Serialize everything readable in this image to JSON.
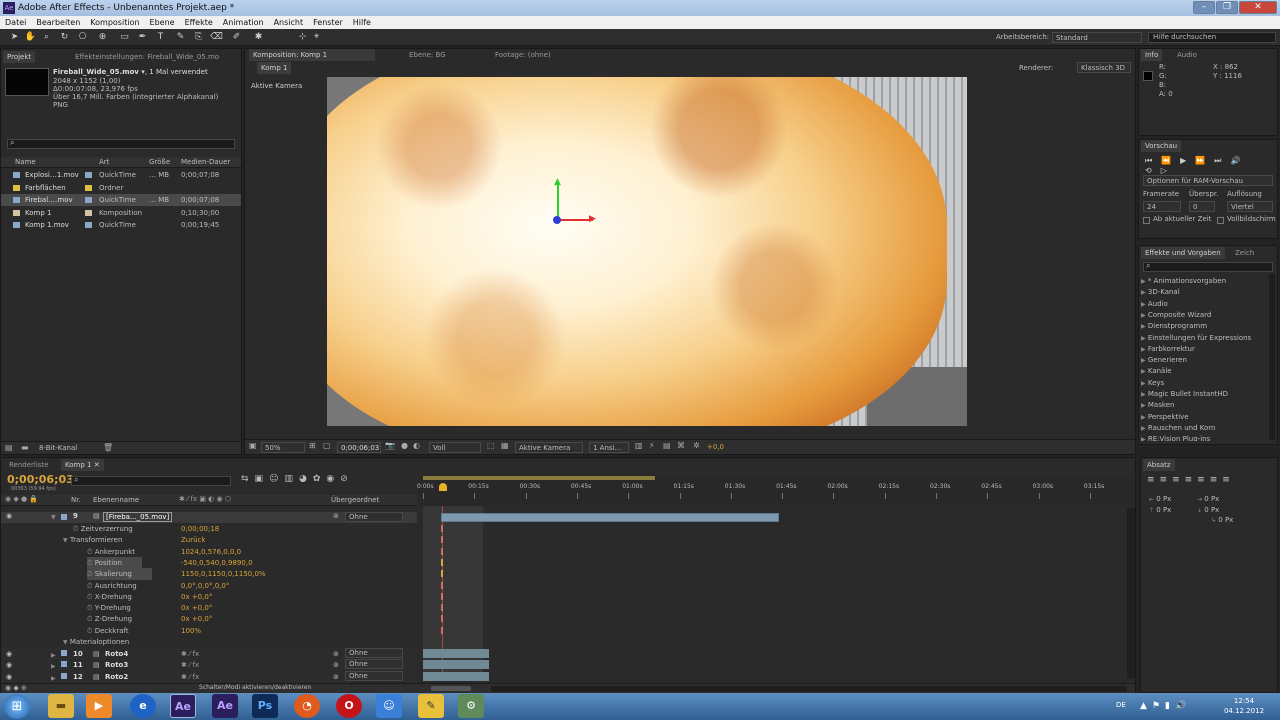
{
  "window": {
    "title": "Adobe After Effects - Unbenanntes Projekt.aep *"
  },
  "menu": [
    "Datei",
    "Bearbeiten",
    "Komposition",
    "Ebene",
    "Effekte",
    "Animation",
    "Ansicht",
    "Fenster",
    "Hilfe"
  ],
  "toolbar": {
    "workspace_label": "Arbeitsbereich:",
    "workspace_value": "Standard",
    "help_placeholder": "Hilfe durchsuchen"
  },
  "project": {
    "tab": "Projekt",
    "tab2": "Effekteinstellungen: Fireball_Wide_05.mo",
    "file_name": "Fireball_Wide_05.mov ▾",
    "used": ", 1 Mal verwendet",
    "info": [
      "2048 x 1152 (1,00)",
      "Δ0:00:07:08, 23,976 fps",
      "Über 16,7 Mill. Farben (integrierter Alphakanal)",
      "PNG"
    ],
    "columns": [
      "Name",
      "Art",
      "Größe",
      "Medien-Dauer"
    ],
    "items": [
      {
        "name": "Explosi…1.mov",
        "type": "QuickTime",
        "size": "… MB",
        "dur": "0;00;07;08",
        "color": "#8aa7c9"
      },
      {
        "name": "Farbflächen",
        "type": "Ordner",
        "size": "",
        "dur": "",
        "color": "#e0c040"
      },
      {
        "name": "Firebal….mov",
        "type": "QuickTime",
        "size": "… MB",
        "dur": "0;00;07;08",
        "color": "#8aa7c9"
      },
      {
        "name": "Komp 1",
        "type": "Komposition",
        "size": "",
        "dur": "0;10;30;00",
        "color": "#d4c5a0"
      },
      {
        "name": "Komp 1.mov",
        "type": "QuickTime",
        "size": "",
        "dur": "0;00;19;45",
        "color": "#8aa7c9"
      }
    ],
    "bitdepth": "8-Bit-Kanal"
  },
  "comp": {
    "tab": "Komposition: Komp 1",
    "tab_layer": "Ebene: BG",
    "tab_footage": "Footage: (ohne)",
    "subtab": "Komp 1",
    "renderer_label": "Renderer:",
    "renderer": "Klassisch 3D",
    "camera_label": "Aktive Kamera",
    "zoom": "50%",
    "timecode": "0;00;06;03",
    "resolution": "Voll",
    "view": "Aktive Kamera",
    "views": "1 Ansi...",
    "exposure": "+0,0"
  },
  "info_panel": {
    "tab": "Info",
    "tab2": "Audio",
    "r": "R:",
    "g": "G:",
    "b": "B:",
    "a": "A: 0",
    "x": "X : 862",
    "y": "Y : 1116"
  },
  "preview": {
    "tab": "Vorschau",
    "options": "Optionen für RAM-Vorschau",
    "framerate_label": "Framerate",
    "skip_label": "Überspr.",
    "res_label": "Auflösung",
    "framerate": "24",
    "skip": "0",
    "res": "Viertel",
    "from_current": "Ab aktueller Zeit",
    "fullscreen": "Vollbildschirm"
  },
  "effects": {
    "tab": "Effekte und Vorgaben",
    "tab2": "Zeich",
    "items": [
      "* Animationsvorgaben",
      "3D-Kanal",
      "Audio",
      "Composite Wizard",
      "Dienstprogramm",
      "Einstellungen für Expressions",
      "Farbkorrektur",
      "Generieren",
      "Kanäle",
      "Keys",
      "Magic Bullet InstantHD",
      "Masken",
      "Perspektive",
      "Rauschen und Korn",
      "RE:Vision Plug-ins"
    ]
  },
  "paragraph": {
    "tab": "Absatz",
    "values": [
      "0 Px",
      "0 Px",
      "0 Px",
      "0 Px",
      "0 Px"
    ]
  },
  "timeline": {
    "tab1": "Renderliste",
    "tab2": "Komp 1",
    "timecode": "0;00;06;03",
    "frames": "00363 (59.94 fps)",
    "col_nr": "Nr.",
    "col_name": "Ebenenname",
    "col_parent": "Übergeordnet",
    "ruler": [
      "0:00s",
      "00:15s",
      "00:30s",
      "00:45s",
      "01:00s",
      "01:15s",
      "01:30s",
      "01:45s",
      "02:00s",
      "02:15s",
      "02:30s",
      "02:45s",
      "03:00s",
      "03:15s"
    ],
    "layer9": {
      "nr": "9",
      "name": "[Fireba..._05.mov]",
      "parent": "Ohne"
    },
    "props": [
      {
        "label": "Zeitverzerrung",
        "value": "0;00;00;18",
        "indent": 1
      },
      {
        "label": "Transformieren",
        "value": "Zurück",
        "indent": 0
      },
      {
        "label": "Ankerpunkt",
        "value": "1024,0,576,0,0,0",
        "indent": 2
      },
      {
        "label": "Position",
        "value": "-540,0,540,0,9890,0",
        "indent": 2
      },
      {
        "label": "Skalierung",
        "value": "1150,0,1150,0,1150,0%",
        "indent": 2
      },
      {
        "label": "Ausrichtung",
        "value": "0,0°,0,0°,0,0°",
        "indent": 2
      },
      {
        "label": "X-Drehung",
        "value": "0x +0,0°",
        "indent": 2
      },
      {
        "label": "Y-Drehung",
        "value": "0x +0,0°",
        "indent": 2
      },
      {
        "label": "Z-Drehung",
        "value": "0x +0,0°",
        "indent": 2
      },
      {
        "label": "Deckkraft",
        "value": "100%",
        "indent": 2
      },
      {
        "label": "Materialoptionen",
        "value": "",
        "indent": 0
      }
    ],
    "layers": [
      {
        "nr": "10",
        "name": "Roto4",
        "parent": "Ohne"
      },
      {
        "nr": "11",
        "name": "Roto3",
        "parent": "Ohne"
      },
      {
        "nr": "12",
        "name": "Roto2",
        "parent": "Ohne"
      }
    ],
    "switch_label": "Schalter/Modi aktivieren/deaktivieren"
  },
  "taskbar": {
    "lang": "DE",
    "time": "12:54",
    "date": "04.12.2012"
  }
}
